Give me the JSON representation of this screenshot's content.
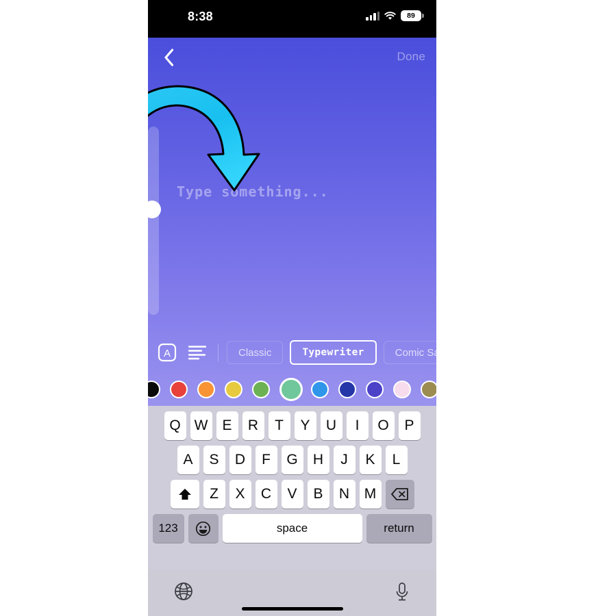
{
  "status_bar": {
    "time": "8:38",
    "battery_level": "89",
    "signal_icon": "signal-bars-icon",
    "wifi_icon": "wifi-icon",
    "battery_icon": "battery-icon"
  },
  "editor": {
    "back_icon": "back-chevron-icon",
    "done_label": "Done",
    "placeholder": "Type something...",
    "background_top_color": "#4a4edb",
    "background_bottom_color": "#9a93ef",
    "size_slider": {
      "name": "text-size-slider",
      "thumb_name": "text-size-slider-thumb"
    },
    "annotation": {
      "name": "curved-arrow-annotation",
      "fill_color": "#22c3f0",
      "stroke_color": "#000000"
    }
  },
  "font_toolbar": {
    "text_style_icon": "letter-a-boxed-icon",
    "align_icon": "text-align-left-icon",
    "fonts": [
      {
        "label": "Classic",
        "selected": false
      },
      {
        "label": "Typewriter",
        "selected": true
      },
      {
        "label": "Comic Sa",
        "selected": false
      }
    ]
  },
  "colors": {
    "swatches": [
      {
        "name": "color-black",
        "hex": "#0a0a0a",
        "selected": false
      },
      {
        "name": "color-red",
        "hex": "#e8403a",
        "selected": false
      },
      {
        "name": "color-orange",
        "hex": "#f89434",
        "selected": false
      },
      {
        "name": "color-yellow",
        "hex": "#e8ca3e",
        "selected": false
      },
      {
        "name": "color-green",
        "hex": "#6cb254",
        "selected": false
      },
      {
        "name": "color-mint",
        "hex": "#6fc79b",
        "selected": true
      },
      {
        "name": "color-blue",
        "hex": "#2f96ea",
        "selected": false
      },
      {
        "name": "color-navy",
        "hex": "#2537a8",
        "selected": false
      },
      {
        "name": "color-indigo",
        "hex": "#4b42c8",
        "selected": false
      },
      {
        "name": "color-pink",
        "hex": "#f6dced",
        "selected": false
      },
      {
        "name": "color-olive",
        "hex": "#9c8c50",
        "selected": false
      }
    ]
  },
  "keyboard": {
    "row1": [
      "Q",
      "W",
      "E",
      "R",
      "T",
      "Y",
      "U",
      "I",
      "O",
      "P"
    ],
    "row2": [
      "A",
      "S",
      "D",
      "F",
      "G",
      "H",
      "J",
      "K",
      "L"
    ],
    "row3": [
      "Z",
      "X",
      "C",
      "V",
      "B",
      "N",
      "M"
    ],
    "shift_icon": "shift-up-arrow-icon",
    "delete_icon": "backspace-delete-icon",
    "numbers_label": "123",
    "emoji_icon": "emoji-smiley-icon",
    "space_label": "space",
    "return_label": "return",
    "globe_icon": "globe-language-icon",
    "mic_icon": "microphone-icon"
  }
}
